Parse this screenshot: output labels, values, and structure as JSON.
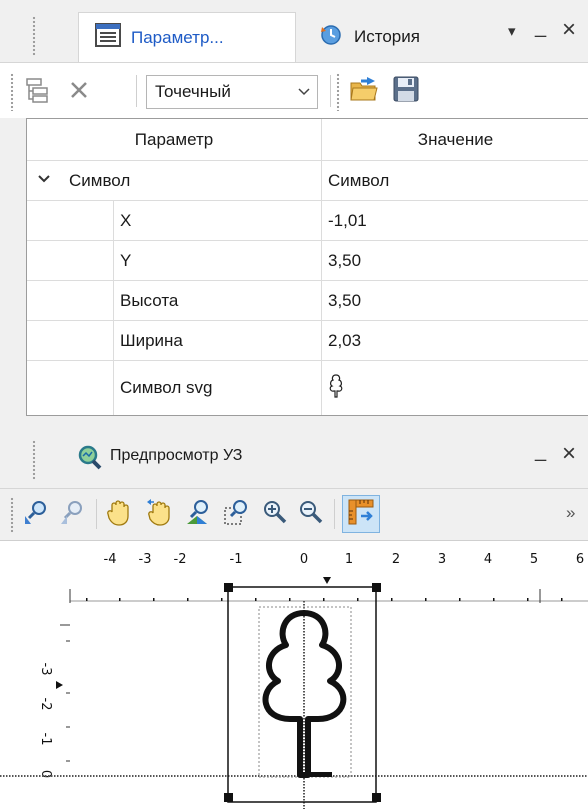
{
  "params_panel": {
    "tab_params_label": "Параметр...",
    "tab_history_label": "История",
    "menu_arrow": "▾",
    "minimize": "_",
    "close": "×"
  },
  "toolbar": {
    "symbol_type_value": "Точечный"
  },
  "grid": {
    "header_param": "Параметр",
    "header_value": "Значение",
    "expand_glyph": "⌄",
    "group": {
      "name": "Символ",
      "value": "Символ"
    },
    "rows": [
      {
        "name": "X",
        "value": "-1,01"
      },
      {
        "name": "Y",
        "value": "3,50"
      },
      {
        "name": "Высота",
        "value": "3,50"
      },
      {
        "name": "Ширина",
        "value": "2,03"
      },
      {
        "name": "Символ svg",
        "value": ""
      }
    ]
  },
  "preview_panel": {
    "title": "Предпросмотр УЗ",
    "minimize": "_",
    "close": "×",
    "overflow": "»"
  },
  "ruler": {
    "top_ticks": [
      "-4",
      "-3",
      "-2",
      "-1",
      "0",
      "1",
      "2",
      "3",
      "4",
      "5",
      "6"
    ],
    "left_ticks": [
      "-3",
      "-2",
      "-1",
      "0"
    ]
  },
  "colors": {
    "accent": "#1e5bc6",
    "grid_line": "#dcdcdc",
    "panel_bg": "#f0f0f0"
  }
}
